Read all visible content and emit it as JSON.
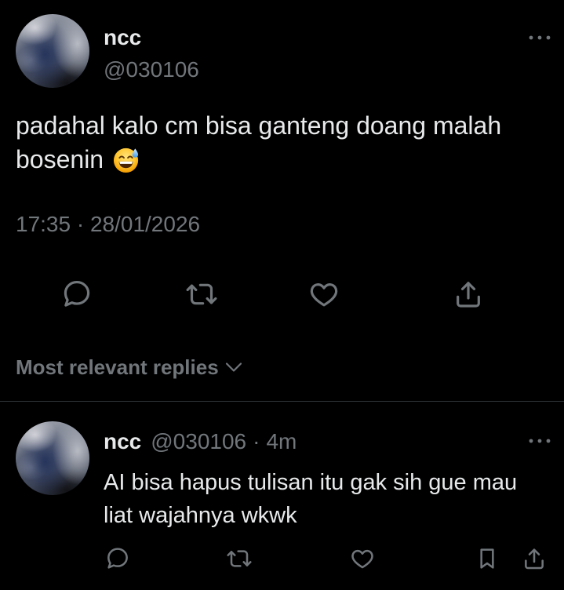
{
  "post": {
    "author": {
      "display_name": "ncc",
      "handle": "@030106"
    },
    "text": "padahal kalo cm bisa ganteng doang malah bosenin",
    "emoji_icon": "grinning-face-with-sweat-emoji-icon",
    "timestamp": "17:35 · 28/01/2026",
    "more_icon": "more-horizontal-icon",
    "action_icons": [
      "reply-icon",
      "repost-icon",
      "heart-icon",
      "share-icon"
    ]
  },
  "replies_sort": {
    "label": "Most relevant replies",
    "icon": "chevron-down-icon"
  },
  "replies": [
    {
      "author": {
        "display_name": "ncc",
        "handle": "@030106"
      },
      "separator": "·",
      "time": "4m",
      "text": "AI bisa hapus tulisan itu gak sih gue mau liat wajahnya wkwk",
      "more_icon": "more-horizontal-icon",
      "action_icons": [
        "reply-icon",
        "repost-icon",
        "heart-icon",
        "bookmark-icon",
        "share-icon"
      ]
    }
  ],
  "colors": {
    "background": "#000000",
    "text_primary": "#e7e9ea",
    "text_secondary": "#71767b",
    "divider": "#2f3336"
  }
}
